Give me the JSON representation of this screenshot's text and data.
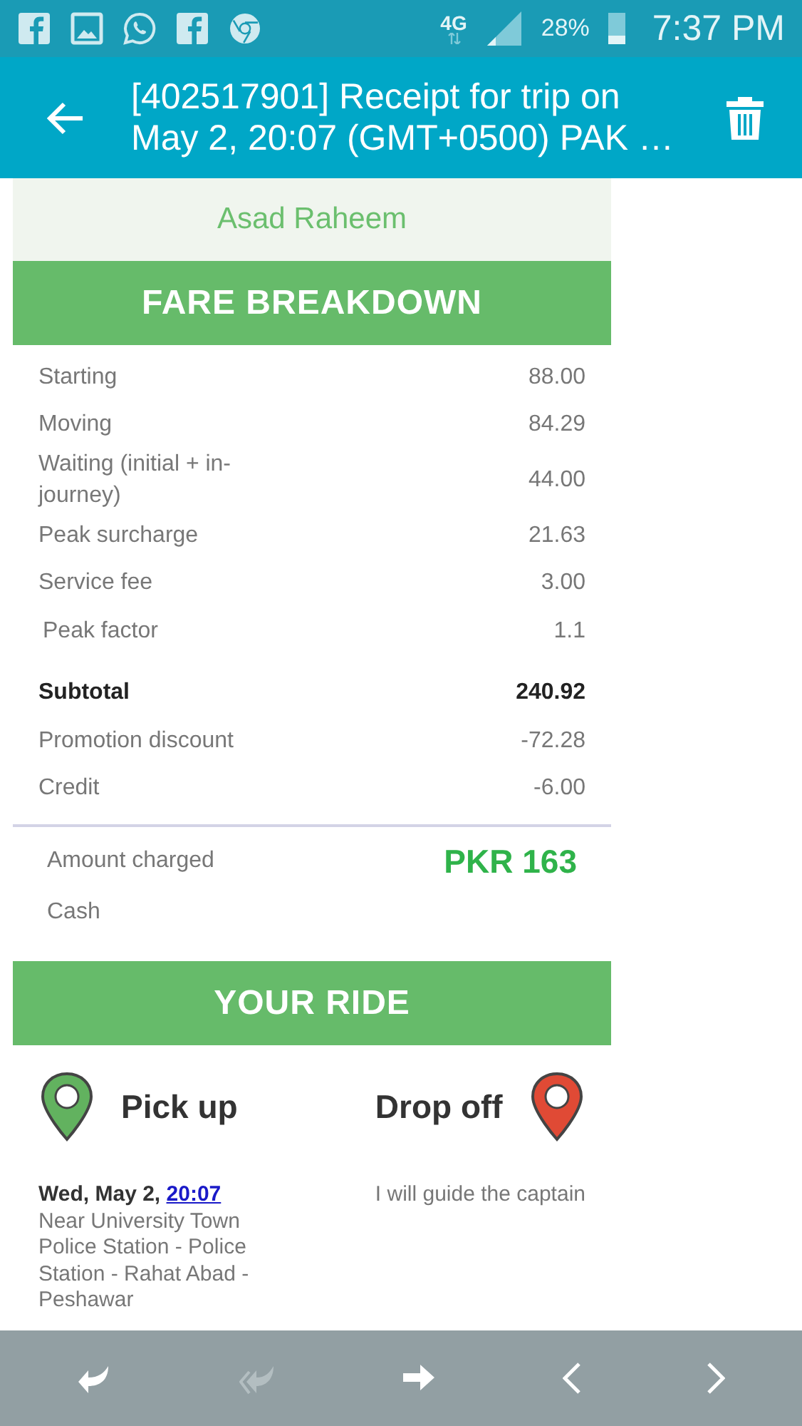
{
  "status_bar": {
    "network": "4G",
    "battery": "28%",
    "time": "7:37 PM"
  },
  "app_bar": {
    "title": "[402517901] Receipt for trip on May 2, 20:07 (GMT+0500) PAK …"
  },
  "captain": {
    "name": "Asad Raheem"
  },
  "fare": {
    "heading": "FARE BREAKDOWN",
    "rows": [
      {
        "kind": "line",
        "label": "Starting",
        "value": "88.00"
      },
      {
        "kind": "line",
        "label": "Moving",
        "value": "84.29"
      },
      {
        "kind": "line",
        "label": "Waiting (initial + in-journey)",
        "value": "44.00"
      },
      {
        "kind": "line",
        "label": "Peak surcharge",
        "value": "21.63"
      },
      {
        "kind": "line",
        "label": "Service fee",
        "value": "3.00"
      },
      {
        "kind": "factor",
        "label": "Peak factor",
        "value": "1.1"
      },
      {
        "kind": "subtotal",
        "label": "Subtotal",
        "value": "240.92"
      },
      {
        "kind": "line",
        "label": "Promotion discount",
        "value": "-72.28"
      },
      {
        "kind": "line",
        "label": "Credit",
        "value": "-6.00"
      }
    ],
    "amount_label": "Amount charged",
    "amount": "PKR 163",
    "payment": "Cash"
  },
  "ride": {
    "heading": "YOUR RIDE",
    "pickup_title": "Pick up",
    "dropoff_title": "Drop off",
    "pickup_date": "Wed, May 2, ",
    "pickup_time": "20:07",
    "pickup_address": "Near University Town Police Station - Police Station - Rahat Abad - Peshawar",
    "dropoff_note": "I will guide the captain"
  },
  "bottom_bar": [
    {
      "kind": "reply",
      "disabled": false
    },
    {
      "kind": "reply-all",
      "disabled": true
    },
    {
      "kind": "forward",
      "disabled": false
    },
    {
      "kind": "previous",
      "disabled": false
    },
    {
      "kind": "next",
      "disabled": false
    }
  ]
}
